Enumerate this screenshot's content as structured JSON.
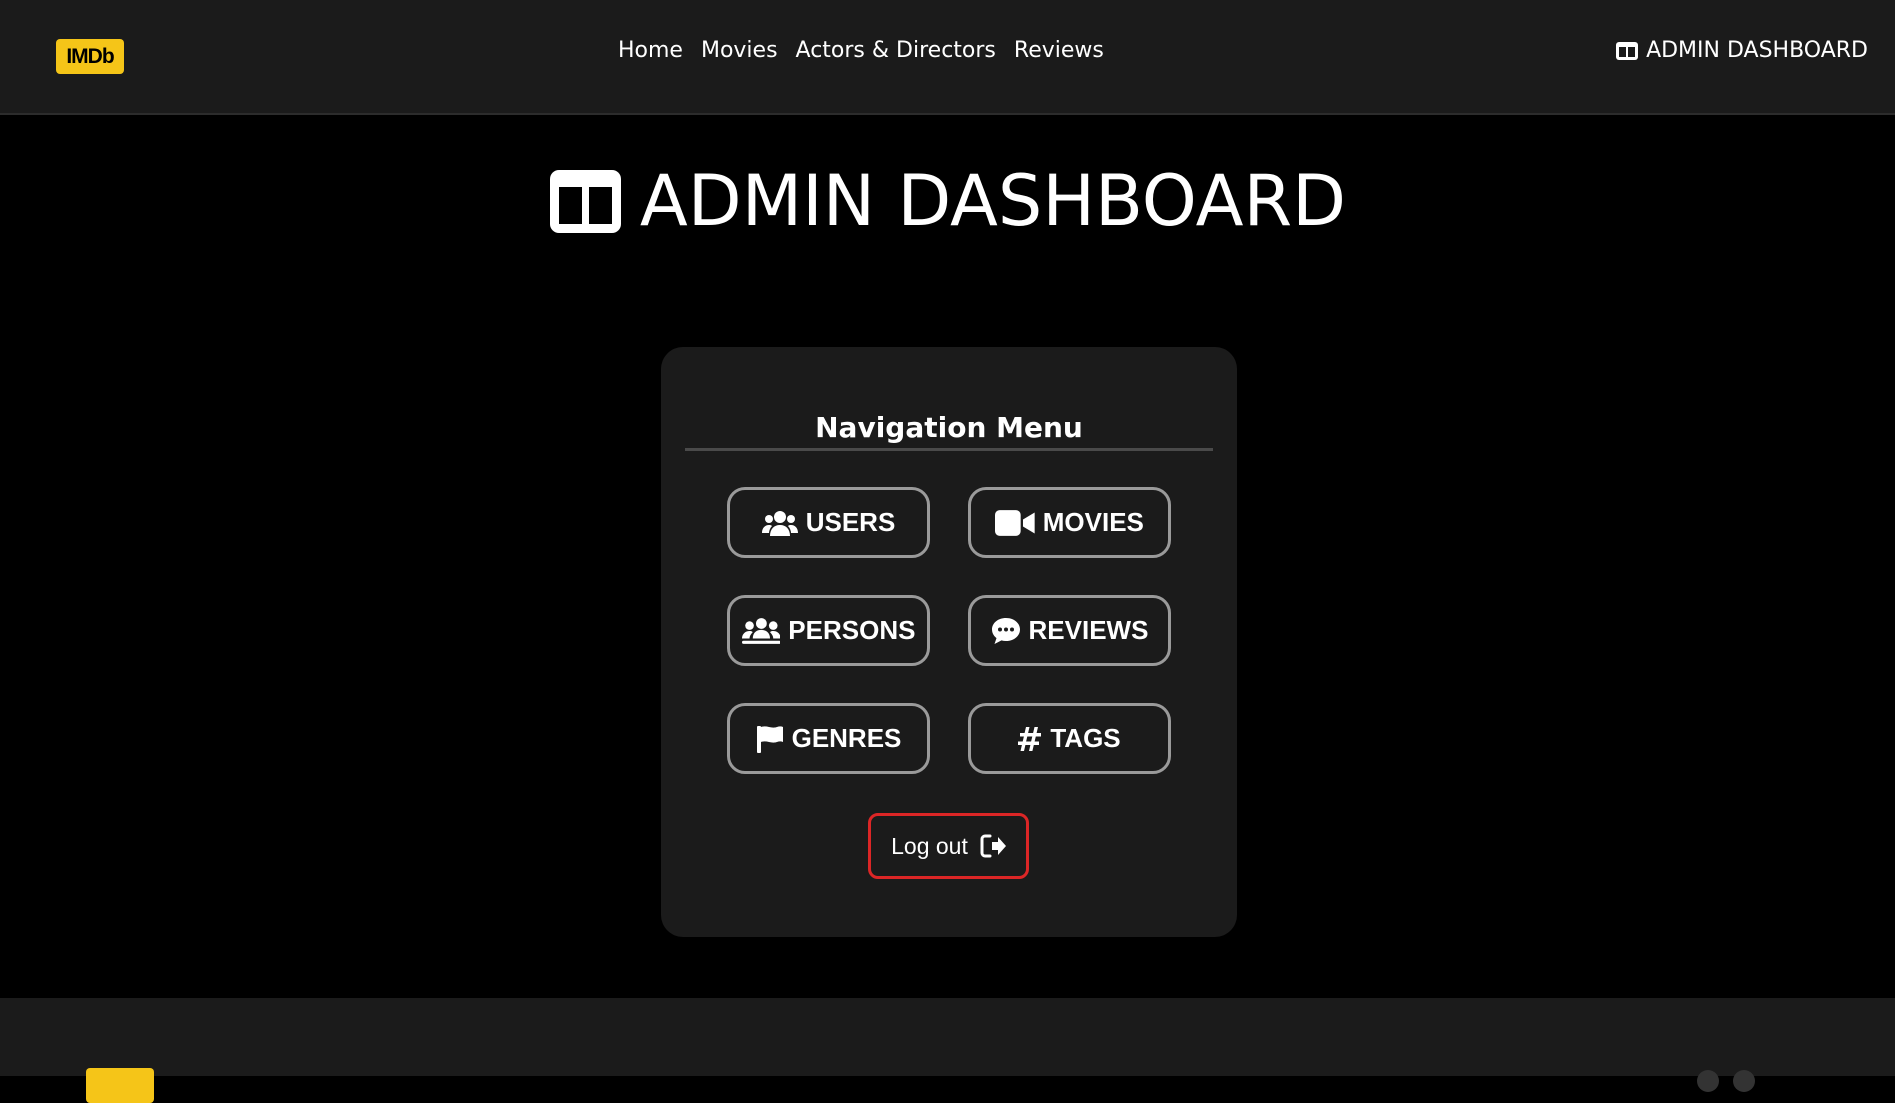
{
  "header": {
    "logo": "IMDb",
    "nav": [
      {
        "label": "Home"
      },
      {
        "label": "Movies"
      },
      {
        "label": "Actors & Directors"
      },
      {
        "label": "Reviews"
      }
    ],
    "admin_link": "ADMIN DASHBOARD",
    "admin_icon": "columns-icon"
  },
  "page": {
    "title": "ADMIN DASHBOARD",
    "title_icon": "columns-icon"
  },
  "card": {
    "heading": "Navigation Menu",
    "buttons": [
      {
        "label": "USERS",
        "icon": "users-icon"
      },
      {
        "label": "MOVIES",
        "icon": "video-camera-icon"
      },
      {
        "label": "PERSONS",
        "icon": "people-group-icon"
      },
      {
        "label": "REVIEWS",
        "icon": "comment-icon"
      },
      {
        "label": "GENRES",
        "icon": "flag-icon"
      },
      {
        "label": "TAGS",
        "icon": "hashtag-icon"
      }
    ],
    "logout": {
      "label": "Log out",
      "icon": "sign-out-icon"
    }
  },
  "colors": {
    "background": "#000000",
    "surface": "#1b1b1b",
    "brand": "#f5c518",
    "button_border": "#9a9a9a",
    "logout_border": "#dc2626"
  }
}
